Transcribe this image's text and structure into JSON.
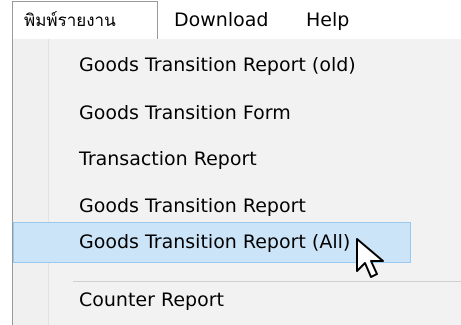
{
  "menubar": {
    "items": [
      {
        "label": "พิมพ์รายงาน"
      },
      {
        "label": "Download"
      },
      {
        "label": "Help"
      }
    ]
  },
  "dropdown": {
    "items": [
      {
        "label": "Goods Transition Report (old)"
      },
      {
        "label": "Goods Transition Form"
      },
      {
        "label": "Transaction Report"
      },
      {
        "label": "Goods Transition Report"
      },
      {
        "label": "Goods Transition Report (All)",
        "highlighted": true
      },
      {
        "label": "Counter Report"
      }
    ],
    "highlight_color": "#cce4f7",
    "highlight_border_color": "#99c9ef"
  },
  "cursor": {
    "icon": "arrow-cursor-icon"
  }
}
